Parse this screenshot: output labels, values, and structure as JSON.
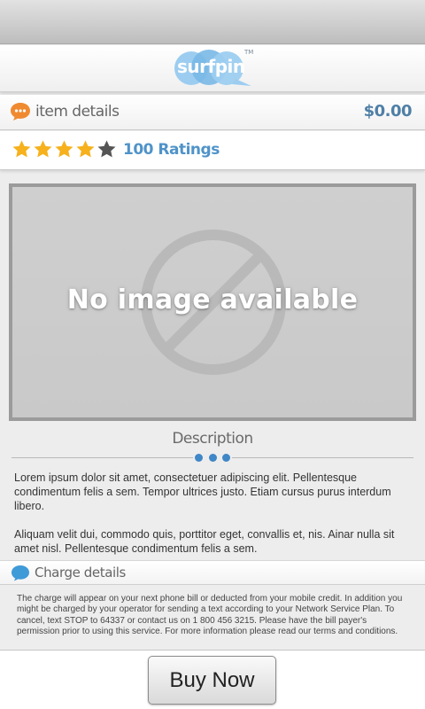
{
  "logo": {
    "text": "surfpin",
    "trademark": "TM"
  },
  "item": {
    "title": "item details",
    "price": "$0.00",
    "rating": {
      "stars_filled": 4,
      "stars_total": 5,
      "ratings_label": "100 Ratings"
    },
    "image_placeholder_text": "No image available"
  },
  "description": {
    "title": "Description",
    "paragraphs": [
      "Lorem ipsum dolor sit amet, consectetuer adipiscing elit. Pellentesque condimentum felis a sem. Tempor ultrices justo. Etiam cursus purus interdum libero.",
      "Aliquam velit dui, commodo quis, porttitor eget, convallis et, nis. Ainar nulla sit amet nisl.   Pellentesque condimentum felis a sem."
    ]
  },
  "charge": {
    "title": "Charge details",
    "body": "The charge will appear on your next phone bill or deducted from your mobile credit. In addition you might be charged by your operator for sending a text according to your Network Service Plan. To cancel, text STOP to 64337 or contact us on 1 800 456 3215. Please have the bill payer's permission prior to using this service. For more information please read our terms and conditions."
  },
  "actions": {
    "buy_label": "Buy Now"
  },
  "colors": {
    "accent_blue": "#4f93c9",
    "price_blue": "#4f7fa6",
    "star_gold": "#f6b11c",
    "star_empty": "#555555",
    "bubble_orange": "#f08a30",
    "bubble_blue": "#3f9ad8"
  }
}
